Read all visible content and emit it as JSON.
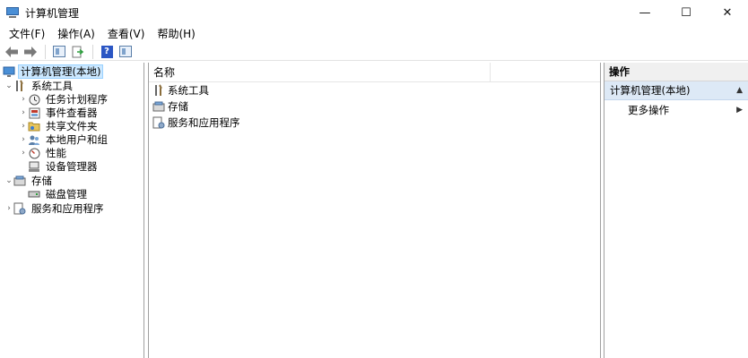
{
  "window": {
    "title": "计算机管理",
    "minimize": "—",
    "maximize": "☐",
    "close": "✕"
  },
  "menu": [
    "文件(F)",
    "操作(A)",
    "查看(V)",
    "帮助(H)"
  ],
  "toolbar": {
    "back": "🡐",
    "forward": "🡒",
    "help": "?"
  },
  "tree": {
    "root": "计算机管理(本地)",
    "system_tools": "系统工具",
    "task_scheduler": "任务计划程序",
    "event_viewer": "事件查看器",
    "shared_folders": "共享文件夹",
    "local_users_groups": "本地用户和组",
    "performance": "性能",
    "device_manager": "设备管理器",
    "storage": "存储",
    "disk_management": "磁盘管理",
    "services_apps": "服务和应用程序"
  },
  "list": {
    "column_name": "名称",
    "rows": [
      "系统工具",
      "存储",
      "服务和应用程序"
    ]
  },
  "actions": {
    "header": "操作",
    "section_title": "计算机管理(本地)",
    "more_actions": "更多操作"
  },
  "colors": {
    "selection": "#cce8ff",
    "actions_section_bg": "#dde9f6"
  }
}
